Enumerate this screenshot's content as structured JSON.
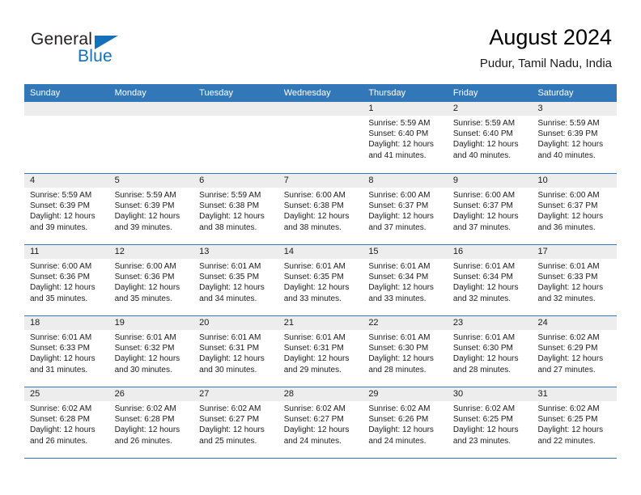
{
  "brand": {
    "name_part1": "General",
    "name_part2": "Blue",
    "accent_color": "#1271b8"
  },
  "header": {
    "title": "August 2024",
    "subtitle": "Pudur, Tamil Nadu, India"
  },
  "calendar": {
    "header_bg": "#3277b8",
    "daynum_bg": "#ededed",
    "weekdays": [
      "Sunday",
      "Monday",
      "Tuesday",
      "Wednesday",
      "Thursday",
      "Friday",
      "Saturday"
    ],
    "weeks": [
      [
        {
          "day": "",
          "sunrise": "",
          "sunset": "",
          "daylight1": "",
          "daylight2": ""
        },
        {
          "day": "",
          "sunrise": "",
          "sunset": "",
          "daylight1": "",
          "daylight2": ""
        },
        {
          "day": "",
          "sunrise": "",
          "sunset": "",
          "daylight1": "",
          "daylight2": ""
        },
        {
          "day": "",
          "sunrise": "",
          "sunset": "",
          "daylight1": "",
          "daylight2": ""
        },
        {
          "day": "1",
          "sunrise": "Sunrise: 5:59 AM",
          "sunset": "Sunset: 6:40 PM",
          "daylight1": "Daylight: 12 hours",
          "daylight2": "and 41 minutes."
        },
        {
          "day": "2",
          "sunrise": "Sunrise: 5:59 AM",
          "sunset": "Sunset: 6:40 PM",
          "daylight1": "Daylight: 12 hours",
          "daylight2": "and 40 minutes."
        },
        {
          "day": "3",
          "sunrise": "Sunrise: 5:59 AM",
          "sunset": "Sunset: 6:39 PM",
          "daylight1": "Daylight: 12 hours",
          "daylight2": "and 40 minutes."
        }
      ],
      [
        {
          "day": "4",
          "sunrise": "Sunrise: 5:59 AM",
          "sunset": "Sunset: 6:39 PM",
          "daylight1": "Daylight: 12 hours",
          "daylight2": "and 39 minutes."
        },
        {
          "day": "5",
          "sunrise": "Sunrise: 5:59 AM",
          "sunset": "Sunset: 6:39 PM",
          "daylight1": "Daylight: 12 hours",
          "daylight2": "and 39 minutes."
        },
        {
          "day": "6",
          "sunrise": "Sunrise: 5:59 AM",
          "sunset": "Sunset: 6:38 PM",
          "daylight1": "Daylight: 12 hours",
          "daylight2": "and 38 minutes."
        },
        {
          "day": "7",
          "sunrise": "Sunrise: 6:00 AM",
          "sunset": "Sunset: 6:38 PM",
          "daylight1": "Daylight: 12 hours",
          "daylight2": "and 38 minutes."
        },
        {
          "day": "8",
          "sunrise": "Sunrise: 6:00 AM",
          "sunset": "Sunset: 6:37 PM",
          "daylight1": "Daylight: 12 hours",
          "daylight2": "and 37 minutes."
        },
        {
          "day": "9",
          "sunrise": "Sunrise: 6:00 AM",
          "sunset": "Sunset: 6:37 PM",
          "daylight1": "Daylight: 12 hours",
          "daylight2": "and 37 minutes."
        },
        {
          "day": "10",
          "sunrise": "Sunrise: 6:00 AM",
          "sunset": "Sunset: 6:37 PM",
          "daylight1": "Daylight: 12 hours",
          "daylight2": "and 36 minutes."
        }
      ],
      [
        {
          "day": "11",
          "sunrise": "Sunrise: 6:00 AM",
          "sunset": "Sunset: 6:36 PM",
          "daylight1": "Daylight: 12 hours",
          "daylight2": "and 35 minutes."
        },
        {
          "day": "12",
          "sunrise": "Sunrise: 6:00 AM",
          "sunset": "Sunset: 6:36 PM",
          "daylight1": "Daylight: 12 hours",
          "daylight2": "and 35 minutes."
        },
        {
          "day": "13",
          "sunrise": "Sunrise: 6:01 AM",
          "sunset": "Sunset: 6:35 PM",
          "daylight1": "Daylight: 12 hours",
          "daylight2": "and 34 minutes."
        },
        {
          "day": "14",
          "sunrise": "Sunrise: 6:01 AM",
          "sunset": "Sunset: 6:35 PM",
          "daylight1": "Daylight: 12 hours",
          "daylight2": "and 33 minutes."
        },
        {
          "day": "15",
          "sunrise": "Sunrise: 6:01 AM",
          "sunset": "Sunset: 6:34 PM",
          "daylight1": "Daylight: 12 hours",
          "daylight2": "and 33 minutes."
        },
        {
          "day": "16",
          "sunrise": "Sunrise: 6:01 AM",
          "sunset": "Sunset: 6:34 PM",
          "daylight1": "Daylight: 12 hours",
          "daylight2": "and 32 minutes."
        },
        {
          "day": "17",
          "sunrise": "Sunrise: 6:01 AM",
          "sunset": "Sunset: 6:33 PM",
          "daylight1": "Daylight: 12 hours",
          "daylight2": "and 32 minutes."
        }
      ],
      [
        {
          "day": "18",
          "sunrise": "Sunrise: 6:01 AM",
          "sunset": "Sunset: 6:33 PM",
          "daylight1": "Daylight: 12 hours",
          "daylight2": "and 31 minutes."
        },
        {
          "day": "19",
          "sunrise": "Sunrise: 6:01 AM",
          "sunset": "Sunset: 6:32 PM",
          "daylight1": "Daylight: 12 hours",
          "daylight2": "and 30 minutes."
        },
        {
          "day": "20",
          "sunrise": "Sunrise: 6:01 AM",
          "sunset": "Sunset: 6:31 PM",
          "daylight1": "Daylight: 12 hours",
          "daylight2": "and 30 minutes."
        },
        {
          "day": "21",
          "sunrise": "Sunrise: 6:01 AM",
          "sunset": "Sunset: 6:31 PM",
          "daylight1": "Daylight: 12 hours",
          "daylight2": "and 29 minutes."
        },
        {
          "day": "22",
          "sunrise": "Sunrise: 6:01 AM",
          "sunset": "Sunset: 6:30 PM",
          "daylight1": "Daylight: 12 hours",
          "daylight2": "and 28 minutes."
        },
        {
          "day": "23",
          "sunrise": "Sunrise: 6:01 AM",
          "sunset": "Sunset: 6:30 PM",
          "daylight1": "Daylight: 12 hours",
          "daylight2": "and 28 minutes."
        },
        {
          "day": "24",
          "sunrise": "Sunrise: 6:02 AM",
          "sunset": "Sunset: 6:29 PM",
          "daylight1": "Daylight: 12 hours",
          "daylight2": "and 27 minutes."
        }
      ],
      [
        {
          "day": "25",
          "sunrise": "Sunrise: 6:02 AM",
          "sunset": "Sunset: 6:28 PM",
          "daylight1": "Daylight: 12 hours",
          "daylight2": "and 26 minutes."
        },
        {
          "day": "26",
          "sunrise": "Sunrise: 6:02 AM",
          "sunset": "Sunset: 6:28 PM",
          "daylight1": "Daylight: 12 hours",
          "daylight2": "and 26 minutes."
        },
        {
          "day": "27",
          "sunrise": "Sunrise: 6:02 AM",
          "sunset": "Sunset: 6:27 PM",
          "daylight1": "Daylight: 12 hours",
          "daylight2": "and 25 minutes."
        },
        {
          "day": "28",
          "sunrise": "Sunrise: 6:02 AM",
          "sunset": "Sunset: 6:27 PM",
          "daylight1": "Daylight: 12 hours",
          "daylight2": "and 24 minutes."
        },
        {
          "day": "29",
          "sunrise": "Sunrise: 6:02 AM",
          "sunset": "Sunset: 6:26 PM",
          "daylight1": "Daylight: 12 hours",
          "daylight2": "and 24 minutes."
        },
        {
          "day": "30",
          "sunrise": "Sunrise: 6:02 AM",
          "sunset": "Sunset: 6:25 PM",
          "daylight1": "Daylight: 12 hours",
          "daylight2": "and 23 minutes."
        },
        {
          "day": "31",
          "sunrise": "Sunrise: 6:02 AM",
          "sunset": "Sunset: 6:25 PM",
          "daylight1": "Daylight: 12 hours",
          "daylight2": "and 22 minutes."
        }
      ]
    ]
  }
}
